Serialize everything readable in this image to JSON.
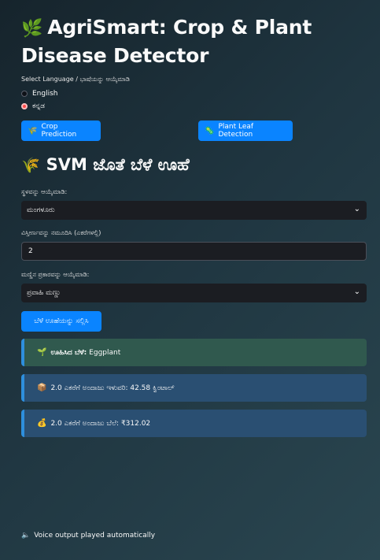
{
  "title": "AgriSmart: Crop & Plant Disease Detector",
  "title_icon": "🌿",
  "language": {
    "label": "Select Language / ಭಾಷೆಯನ್ನು ಆಯ್ಕೆಮಾಡಿ",
    "options": [
      "English",
      "ಕನ್ನಡ"
    ],
    "selected": "ಕನ್ನಡ"
  },
  "nav": {
    "crop_icon": "🌾",
    "crop_label": "Crop Prediction",
    "leaf_icon": "🦠",
    "leaf_label": "Plant Leaf Detection"
  },
  "section": {
    "icon": "🌾",
    "title": "SVM ಜೊತೆ ಬೆಳೆ ಊಹೆ"
  },
  "form": {
    "location_label": "ಸ್ಥಳವನ್ನು ಆಯ್ಕೆಮಾಡಿ:",
    "location_value": "ಮಂಗಳೂರು",
    "area_label": "ವಿಸ್ತೀರ್ಣವನ್ನು ನಮೂದಿಸಿ (ಎಕರೆಗಳಲ್ಲಿ)",
    "area_value": "2",
    "soil_label": "ಮಣ್ಣಿನ ಪ್ರಕಾರವನ್ನು ಆಯ್ಕೆಮಾಡಿ:",
    "soil_value": "ಪ್ರವಾಹಿ ಮಣ್ಣು",
    "submit_label": "ಬೆಳೆ ಊಹೆಯನ್ನು ಸಲ್ಲಿಸಿ"
  },
  "results": {
    "crop_icon": "🌱",
    "crop_prefix": "ಊಹಿಸಿದ ಬೆಳೆ:",
    "crop_value": "Eggplant",
    "yield_icon": "📦",
    "yield_text": "2.0 ಎಕರೆಗೆ ಅಂದಾಜು ಇಳುವರಿ: 42.58 ಕ್ವಿಂಟಾಲ್",
    "price_icon": "💰",
    "price_text": "2.0 ಎಕರೆಗೆ ಅಂದಾಜು ಬೆಲೆ: ₹312.02"
  },
  "voice": {
    "icon": "🔈",
    "text": "Voice output played automatically"
  },
  "colors": {
    "button": "#0a84ff",
    "success_bg": "#30594e",
    "info_bg": "#2a4f72",
    "radio_selected": "#ff4b4b"
  }
}
